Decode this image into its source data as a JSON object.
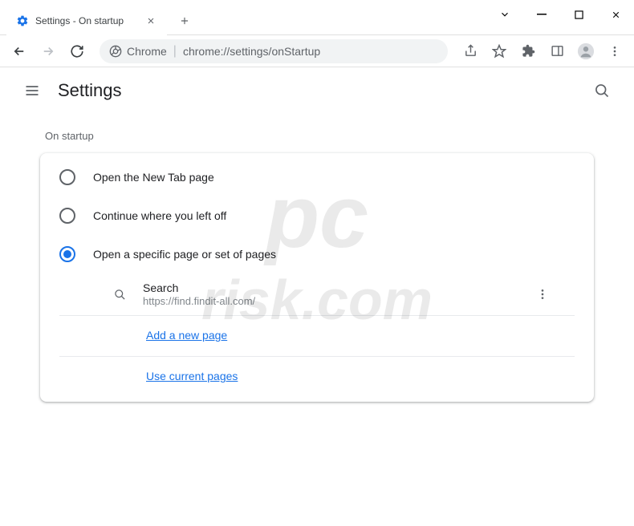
{
  "window": {
    "tab_title": "Settings - On startup"
  },
  "omnibox": {
    "scheme_label": "Chrome",
    "url": "chrome://settings/onStartup"
  },
  "header": {
    "title": "Settings"
  },
  "section": {
    "title": "On startup",
    "options": [
      {
        "label": "Open the New Tab page",
        "selected": false
      },
      {
        "label": "Continue where you left off",
        "selected": false
      },
      {
        "label": "Open a specific page or set of pages",
        "selected": true
      }
    ],
    "pages": [
      {
        "name": "Search",
        "url": "https://find.findit-all.com/"
      }
    ],
    "add_page_label": "Add a new page",
    "use_current_label": "Use current pages"
  }
}
